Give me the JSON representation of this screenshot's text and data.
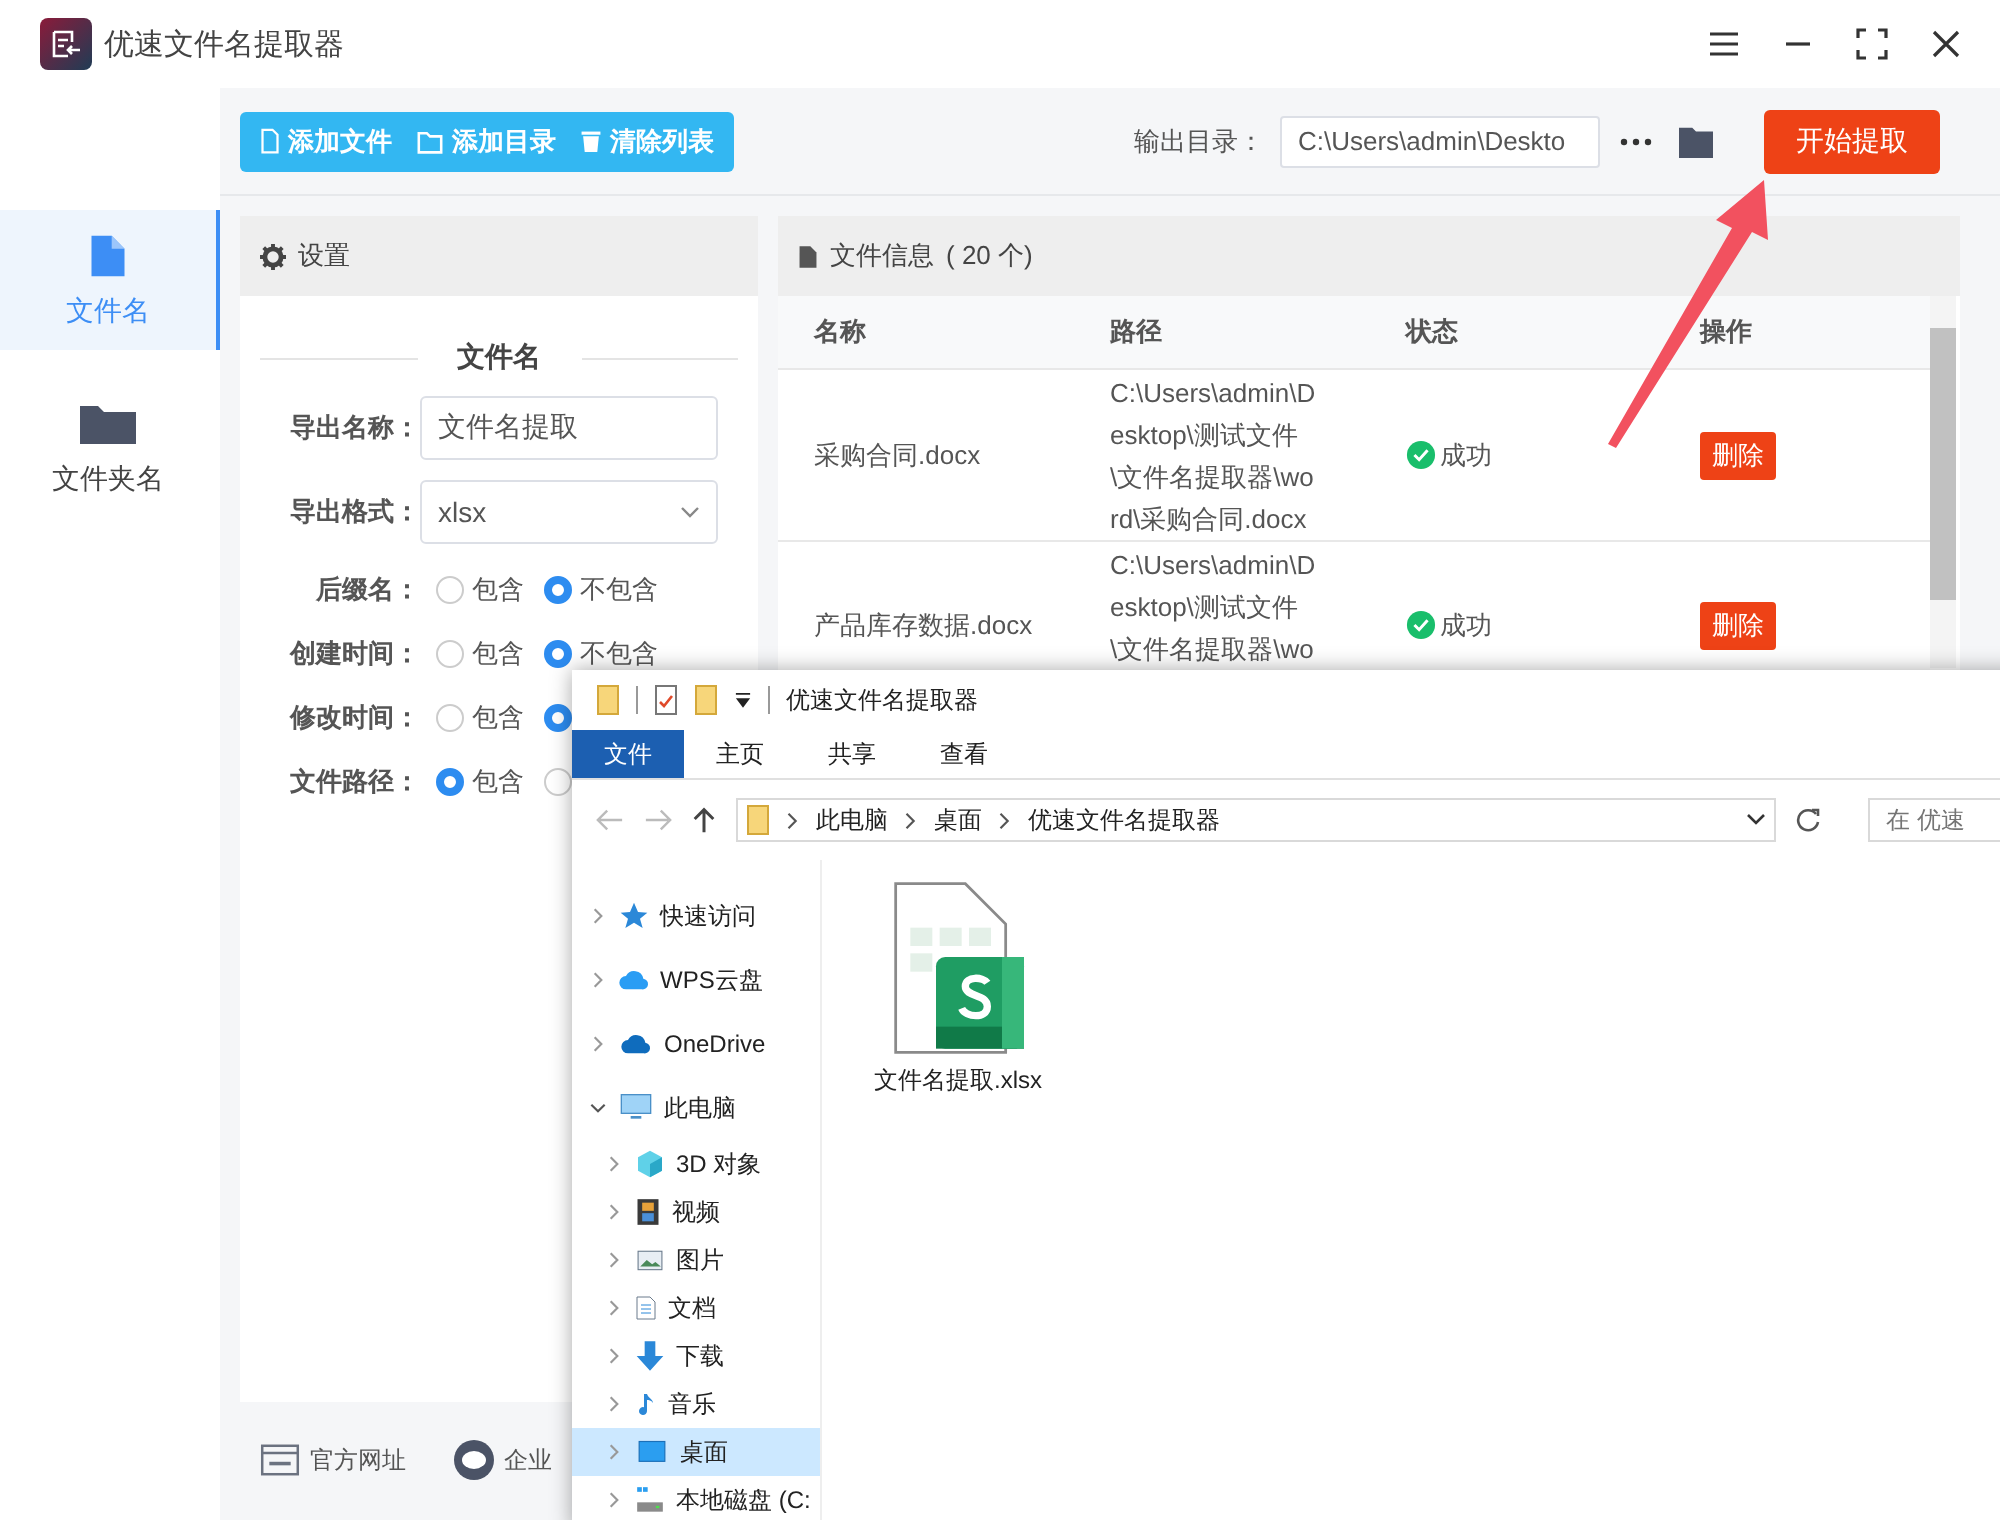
{
  "window": {
    "title": "优速文件名提取器"
  },
  "nav": [
    {
      "label": "文件名",
      "kind": "file",
      "selected": true
    },
    {
      "label": "文件夹名",
      "kind": "folder",
      "selected": false
    }
  ],
  "toolbar": {
    "buttons": [
      {
        "label": "添加文件",
        "kind": "file"
      },
      {
        "label": "添加目录",
        "kind": "folder"
      },
      {
        "label": "清除列表",
        "kind": "trash"
      }
    ],
    "output_label": "输出目录：",
    "output_path": "C:\\Users\\admin\\Deskto",
    "start_button": "开始提取"
  },
  "settings": {
    "title": "设置",
    "section": "文件名",
    "fields": [
      {
        "label": "导出名称：",
        "kind": "text",
        "value": "文件名提取"
      },
      {
        "label": "导出格式：",
        "kind": "select",
        "value": "xlsx"
      },
      {
        "label": "后缀名：",
        "kind": "radio",
        "options": [
          {
            "label": "包含",
            "selected": false
          },
          {
            "label": "不包含",
            "selected": true
          }
        ]
      },
      {
        "label": "创建时间：",
        "kind": "radio",
        "options": [
          {
            "label": "包含",
            "selected": false
          },
          {
            "label": "不包含",
            "selected": true
          }
        ]
      },
      {
        "label": "修改时间：",
        "kind": "radio",
        "options": [
          {
            "label": "包含",
            "selected": false
          },
          {
            "selected": true
          }
        ]
      },
      {
        "label": "文件路径：",
        "kind": "radio",
        "options": [
          {
            "label": "包含",
            "selected": true
          },
          {
            "selected": false
          }
        ]
      }
    ]
  },
  "files": {
    "title": "文件信息",
    "count": "( 20 个)",
    "columns": [
      "名称",
      "路径",
      "状态",
      "操作"
    ],
    "rows": [
      {
        "name": "采购合同.docx",
        "path": "C:\\Users\\admin\\Desktop\\测试文件\\文件名提取器\\word\\采购合同.docx",
        "status": "成功",
        "action": "删除"
      },
      {
        "name": "产品库存数据.docx",
        "path": "C:\\Users\\admin\\Desktop\\测试文件\\文件名提取器\\wo",
        "status": "成功",
        "action": "删除"
      }
    ]
  },
  "footer": [
    {
      "label": "官方网址",
      "kind": "web"
    },
    {
      "label": "企业",
      "kind": "chat"
    }
  ],
  "explorer": {
    "title": "优速文件名提取器",
    "tabs": [
      {
        "label": "文件",
        "selected": true
      },
      {
        "label": "主页",
        "selected": false
      },
      {
        "label": "共享",
        "selected": false
      },
      {
        "label": "查看",
        "selected": false
      }
    ],
    "breadcrumb": [
      "此电脑",
      "桌面",
      "优速文件名提取器"
    ],
    "search_placeholder": "在 优速",
    "tree": [
      {
        "label": "快速访问",
        "kind": "star",
        "expanded": false,
        "selected": false
      },
      {
        "label": "WPS云盘",
        "kind": "wps",
        "expanded": false,
        "selected": false
      },
      {
        "label": "OneDrive",
        "kind": "cloud",
        "expanded": false,
        "selected": false
      },
      {
        "label": "此电脑",
        "kind": "pc",
        "expanded": true,
        "selected": false,
        "children": [
          {
            "label": "3D 对象",
            "kind": "cube",
            "expanded": false,
            "selected": false
          },
          {
            "label": "视频",
            "kind": "film",
            "expanded": false,
            "selected": false
          },
          {
            "label": "图片",
            "kind": "image",
            "expanded": false,
            "selected": false
          },
          {
            "label": "文档",
            "kind": "doc",
            "expanded": false,
            "selected": false
          },
          {
            "label": "下载",
            "kind": "download",
            "expanded": false,
            "selected": false
          },
          {
            "label": "音乐",
            "kind": "music",
            "expanded": false,
            "selected": false
          },
          {
            "label": "桌面",
            "kind": "desktop",
            "expanded": false,
            "selected": true
          },
          {
            "label": "本地磁盘 (C:",
            "kind": "drive",
            "expanded": false,
            "selected": false
          }
        ]
      }
    ],
    "files": [
      {
        "name": "文件名提取.xlsx",
        "kind": "xlsx"
      }
    ]
  }
}
